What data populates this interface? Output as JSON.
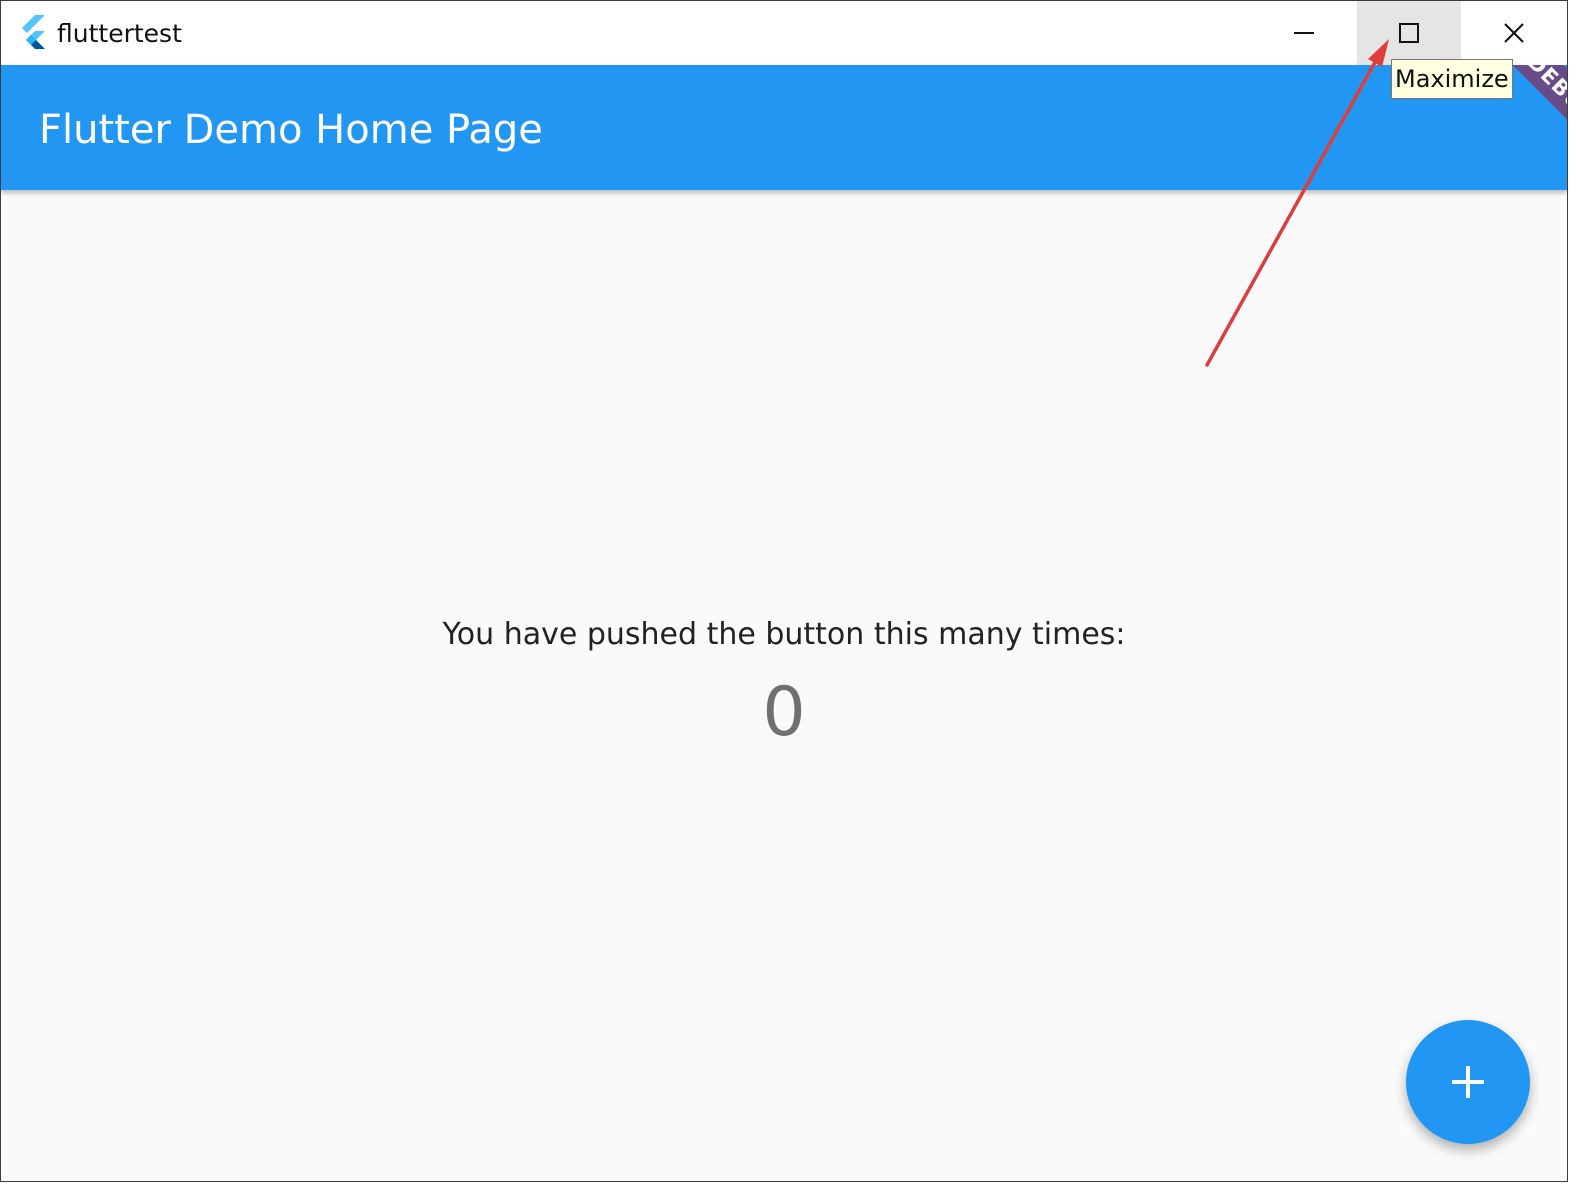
{
  "window": {
    "title": "fluttertest",
    "app_icon": "flutter-logo-icon",
    "controls": {
      "minimize_icon": "minimize-icon",
      "maximize_icon": "maximize-icon",
      "close_icon": "close-icon"
    },
    "tooltip": "Maximize"
  },
  "appbar": {
    "title": "Flutter Demo Home Page",
    "debug_banner": "DEBUG"
  },
  "main": {
    "label": "You have pushed the button this many times:",
    "counter": "0"
  },
  "fab": {
    "icon": "plus-icon"
  },
  "colors": {
    "primary": "#2196f3",
    "background": "#fafafa",
    "annotation_arrow": "#e03c3c",
    "debug_banner": "#b00020"
  }
}
